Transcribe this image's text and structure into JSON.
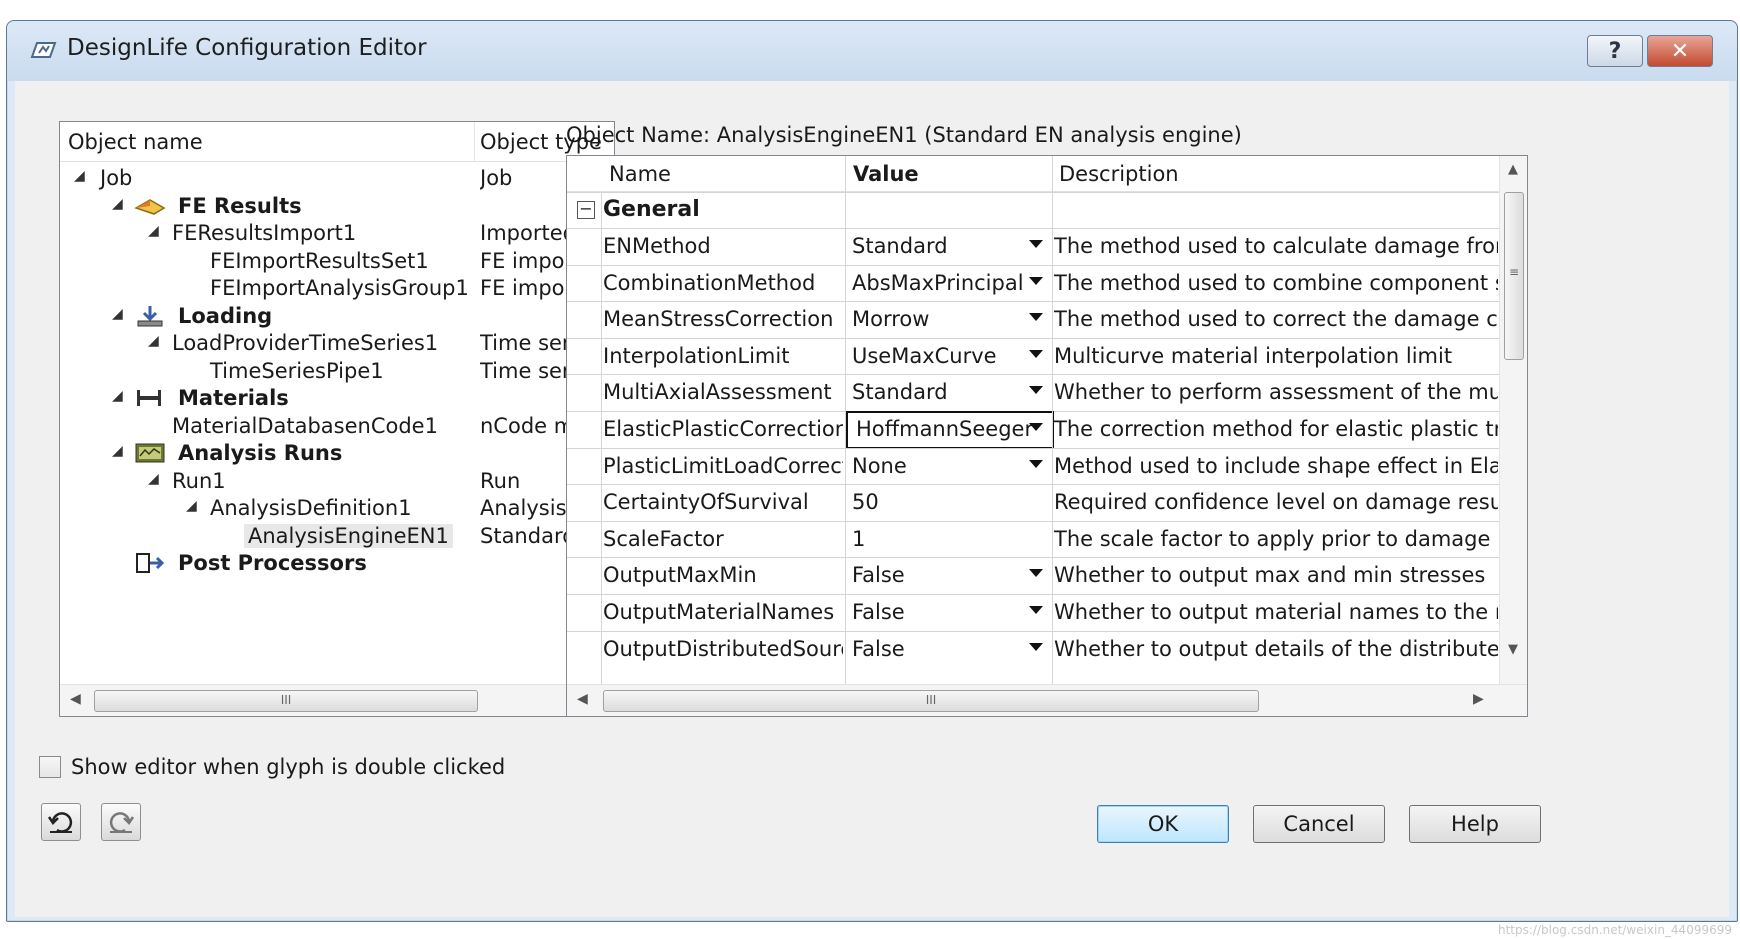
{
  "window": {
    "title": "DesignLife Configuration Editor",
    "help_glyph": "?",
    "close_glyph": "✕"
  },
  "tree": {
    "headers": {
      "name": "Object name",
      "type": "Object type"
    },
    "scroll_glyph": "III",
    "rows": [
      {
        "name": "Job",
        "type": "Job",
        "bold": false
      },
      {
        "name": "FE Results",
        "type": "",
        "bold": true,
        "icon": "fe-results-icon"
      },
      {
        "name": "FEResultsImport1",
        "type": "Imported FE r",
        "bold": false
      },
      {
        "name": "FEImportResultsSet1",
        "type": "FE import resu",
        "bold": false
      },
      {
        "name": "FEImportAnalysisGroup1",
        "type": "FE import ana",
        "bold": false
      },
      {
        "name": "Loading",
        "type": "",
        "bold": true,
        "icon": "loading-icon"
      },
      {
        "name": "LoadProviderTimeSeries1",
        "type": "Time series lo",
        "bold": false
      },
      {
        "name": "TimeSeriesPipe1",
        "type": "Time series in",
        "bold": false
      },
      {
        "name": "Materials",
        "type": "",
        "bold": true,
        "icon": "materials-icon"
      },
      {
        "name": "MaterialDatabasenCode1",
        "type": "nCode materi",
        "bold": false
      },
      {
        "name": "Analysis Runs",
        "type": "",
        "bold": true,
        "icon": "analysis-runs-icon"
      },
      {
        "name": "Run1",
        "type": "Run",
        "bold": false
      },
      {
        "name": "AnalysisDefinition1",
        "type": "Analysis defin",
        "bold": false
      },
      {
        "name": "AnalysisEngineEN1",
        "type": "Standard EN a",
        "bold": false,
        "selected": true
      },
      {
        "name": "Post Processors",
        "type": "",
        "bold": true,
        "icon": "post-processors-icon"
      }
    ]
  },
  "properties": {
    "object_name_label": "Object Name: AnalysisEngineEN1 (Standard EN analysis engine)",
    "headers": {
      "name": "Name",
      "value": "Value",
      "description": "Description"
    },
    "group": {
      "toggle": "−",
      "name": "General"
    },
    "scroll_glyph": "III",
    "rows": [
      {
        "name": "ENMethod",
        "value": "Standard",
        "dropdown": true,
        "description": "The method used to calculate damage from a stre"
      },
      {
        "name": "CombinationMethod",
        "value": "AbsMaxPrincipal",
        "dropdown": true,
        "description": "The method used to combine component stresses,"
      },
      {
        "name": "MeanStressCorrection",
        "value": "Morrow",
        "dropdown": true,
        "description": "The method used to correct the damage calculatio"
      },
      {
        "name": "InterpolationLimit",
        "value": "UseMaxCurve",
        "dropdown": true,
        "description": "Multicurve material interpolation limit"
      },
      {
        "name": "MultiAxialAssessment",
        "value": "Standard",
        "dropdown": true,
        "description": "Whether to perform assessment of the multi-axial"
      },
      {
        "name": "ElasticPlasticCorrection",
        "value": "HoffmannSeeger",
        "dropdown": true,
        "editing": true,
        "description": "The correction method for elastic plastic transform"
      },
      {
        "name": "PlasticLimitLoadCorrection",
        "value": "None",
        "dropdown": true,
        "description": "Method used to include shape effect in Elastic Plas"
      },
      {
        "name": "CertaintyOfSurvival",
        "value": "50",
        "dropdown": false,
        "description": "Required confidence level on damage results"
      },
      {
        "name": "ScaleFactor",
        "value": "1",
        "dropdown": false,
        "description": "The scale factor to apply prior to damage calculati"
      },
      {
        "name": "OutputMaxMin",
        "value": "False",
        "dropdown": true,
        "description": "Whether to output max and min stresses"
      },
      {
        "name": "OutputMaterialNames",
        "value": "False",
        "dropdown": true,
        "description": "Whether to output material names to the results"
      },
      {
        "name": "OutputDistributedSource",
        "value": "False",
        "dropdown": true,
        "description": "Whether to output details of the distributed proce"
      }
    ]
  },
  "footer": {
    "checkbox_label": "Show editor when glyph is double clicked",
    "checkbox_checked": false,
    "ok_label": "OK",
    "cancel_label": "Cancel",
    "help_label": "Help"
  },
  "watermark": "https://blog.csdn.net/weixin_44099699"
}
